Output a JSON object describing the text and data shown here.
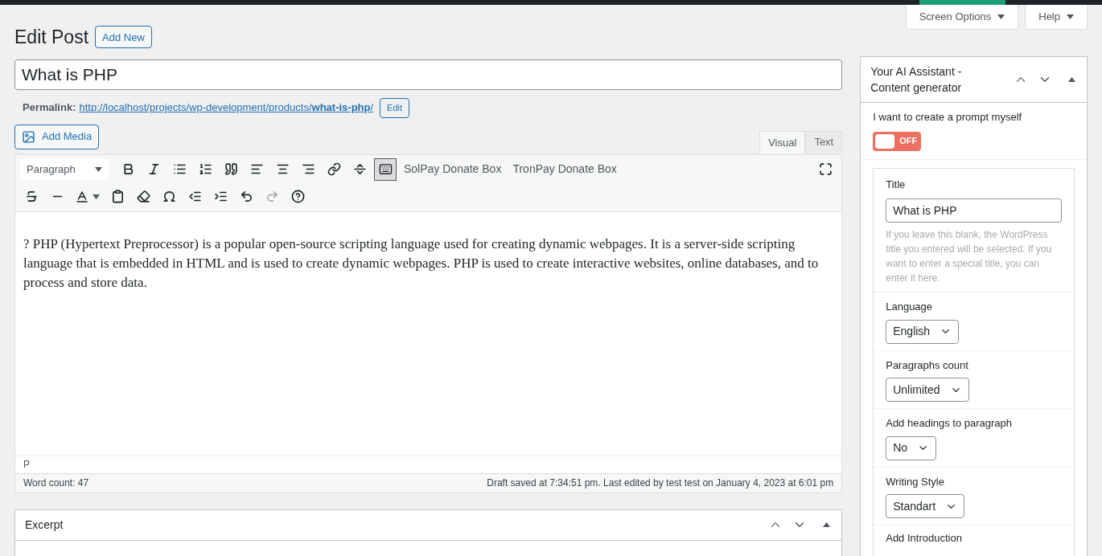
{
  "top_buttons": [
    {
      "label": "Screen Options"
    },
    {
      "label": "Help"
    }
  ],
  "page_title": "Edit Post",
  "add_new": "Add New",
  "post_title": "What is PHP",
  "permalink": {
    "label": "Permalink:",
    "url_base": "http://localhost/projects/wp-development/products/",
    "slug": "what-is-php",
    "trail": "/",
    "edit": "Edit"
  },
  "add_media": "Add Media",
  "editor_tabs": [
    {
      "label": "Visual",
      "selected": true
    },
    {
      "label": "Text",
      "selected": false
    }
  ],
  "toolbar": {
    "format": "Paragraph",
    "toolbar_toggle_on": true,
    "text_buttons": [
      "SolPay Donate Box",
      "TronPay Donate Box"
    ]
  },
  "content": "? PHP (Hypertext Preprocessor) is a popular open-source scripting language used for creating dynamic webpages. It is a server-side scripting language that is embedded in HTML and is used to create dynamic webpages. PHP is used to create interactive websites, online databases, and to process and store data.",
  "path": "P",
  "word_count": "Word count: 47",
  "draft_status": "Draft saved at 7:34:51 pm. Last edited by test test on January 4, 2023 at 6:01 pm",
  "excerpt": {
    "title": "Excerpt"
  },
  "sidebar": {
    "title": "Your AI Assistant - Content generator",
    "toggle": {
      "label": "I want to create a prompt myself",
      "on": false,
      "text": "OFF"
    },
    "title_field": {
      "label": "Title",
      "value": "What is PHP",
      "help": "If you leave this blank, the WordPress title you entered will be selected. If you want to enter a special title, you can enter it here."
    },
    "selects": [
      {
        "label": "Language",
        "value": "English"
      },
      {
        "label": "Paragraphs count",
        "value": "Unlimited"
      },
      {
        "label": "Add headings to paragraph",
        "value": "No"
      },
      {
        "label": "Writing Style",
        "value": "Standart"
      }
    ],
    "cut_label": "Add Introduction"
  }
}
